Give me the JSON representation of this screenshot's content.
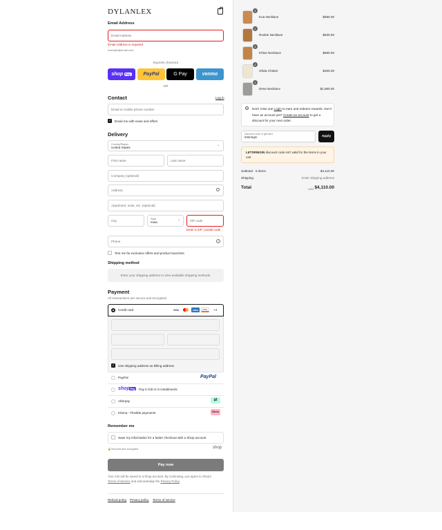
{
  "brand": "DYLANLEX",
  "email": {
    "heading": "Email Address",
    "placeholder": "Email Address",
    "error": "Email Address is required",
    "hint": "example@email.com"
  },
  "express": {
    "label": "Express checkout",
    "shop": "shop",
    "shop_pay": "Pay",
    "paypal": "PayPal",
    "gpay": "G Pay",
    "venmo": "venmo",
    "or": "OR"
  },
  "contact": {
    "heading": "Contact",
    "login": "Log in",
    "placeholder": "Email or mobile phone number",
    "news": "Email me with news and offers"
  },
  "delivery": {
    "heading": "Delivery",
    "country_label": "Country/Region",
    "country": "United States",
    "first": "First name",
    "last": "Last name",
    "company": "Company (optional)",
    "address": "Address",
    "apt": "Apartment, suite, etc. (optional)",
    "city": "City",
    "state_label": "State",
    "state": "Iowa",
    "zip": "ZIP code",
    "zip_error": "Enter a ZIP / postal code",
    "phone": "Phone",
    "sms": "Text me for exclusive offers and product launches"
  },
  "shipping": {
    "heading": "Shipping method",
    "note": "Enter your shipping address to view available shipping methods."
  },
  "payment": {
    "heading": "Payment",
    "secure": "All transactions are secure and encrypted.",
    "credit": "Credit card",
    "more": "+4",
    "cards": [
      "VISA",
      "MC",
      "AMEX",
      "DISC"
    ],
    "billing": "Use shipping address as billing address",
    "paypal": "PayPal",
    "paypal_logo": "PayPal",
    "shoppay": "Pay in full or in installments",
    "shoppay_logo": "shop",
    "shoppay_pay": "Pay",
    "afterpay": "Afterpay",
    "klarna": "Klarna - Flexible payments",
    "klarna_badge": "Klarna."
  },
  "remember": {
    "heading": "Remember me",
    "save": "Save my information for a faster checkout with a Shop account",
    "secure": "Secured and encrypted",
    "shop": "shop"
  },
  "pay_now": "Pay now",
  "legal": {
    "pre": "Your info will be saved to a Shop account. By continuing, you agree to Shop's",
    "terms": "Terms of Service",
    "mid": "and acknowledge the",
    "privacy": "Privacy Policy",
    "end": "."
  },
  "footer": [
    "Refund policy",
    "Privacy policy",
    "Terms of service"
  ],
  "items": [
    {
      "name": "Koa Necklace",
      "price": "$580.00",
      "qty": "1",
      "color": "#c98b4e"
    },
    {
      "name": "Rookie Necklace",
      "price": "$530.00",
      "qty": "1",
      "color": "#b4773e"
    },
    {
      "name": "Khloe Necklace",
      "price": "$580.00",
      "qty": "1",
      "color": "#c38448"
    },
    {
      "name": "Olivia Choker",
      "price": "$460.00",
      "qty": "1",
      "color": "#efe6d2"
    },
    {
      "name": "Drew Necklace",
      "price": "$1,950.00",
      "qty": "1",
      "color": "#9c9c98"
    }
  ],
  "rewards": {
    "pre": "Don't miss out!",
    "login": "Login",
    "mid": "to earn and redeem rewards. Don't have an account yet?",
    "create": "Create an account",
    "end": "to get a discount for your next order."
  },
  "discount": {
    "label": "Discount code or gift card",
    "value": "letsringin",
    "apply": "Apply"
  },
  "warning": {
    "code": "LETSRINGIN",
    "text": "discount code isn't valid for the items in your cart"
  },
  "summary": {
    "subtotal_label": "Subtotal · 5 items",
    "subtotal": "$4,110.00",
    "shipping_label": "Shipping",
    "shipping": "Enter shipping address",
    "total_label": "Total",
    "currency": "USD",
    "total": "$4,110.00"
  }
}
